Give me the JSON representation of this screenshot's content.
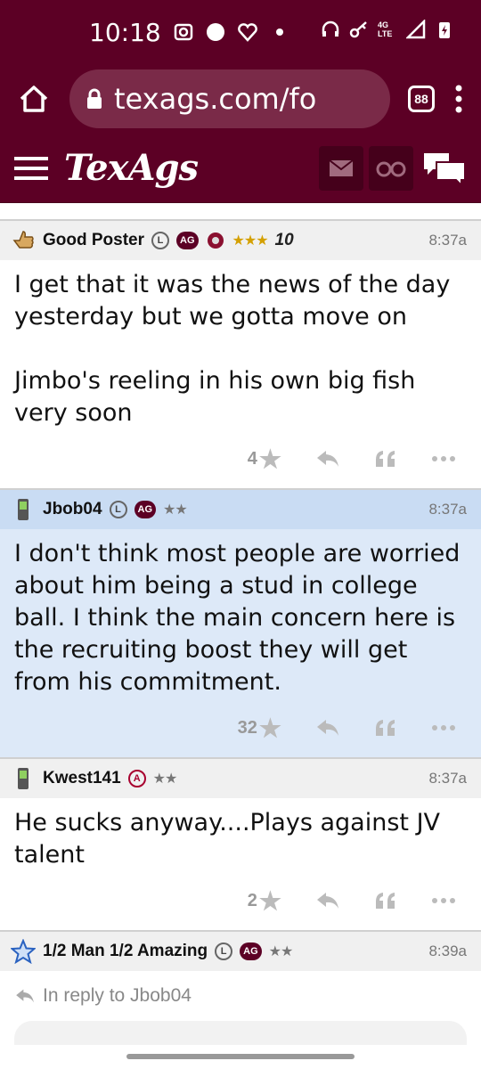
{
  "status": {
    "time": "10:18",
    "network": "4G LTE"
  },
  "browser": {
    "url": "texags.com/fo",
    "tab_count": "88"
  },
  "site": {
    "logo": "TexAgs"
  },
  "posts": [
    {
      "username": "Good Poster",
      "badges": [
        "L",
        "AG"
      ],
      "stars": "★★★",
      "ten": "10",
      "time": "8:37a",
      "body": "I get that it was the news of the day yesterday but we gotta move on\n\nJimbo's reeling in his own big fish very soon",
      "likes": "4",
      "highlighted": false
    },
    {
      "username": "Jbob04",
      "badges": [
        "L",
        "AG"
      ],
      "stars": "★★",
      "time": "8:37a",
      "body": "I don't think most people are worried about him being a stud in college ball. I think the main concern here is the recruiting boost they will get from his commitment.",
      "likes": "32",
      "highlighted": true
    },
    {
      "username": "Kwest141",
      "badges": [
        "A"
      ],
      "stars": "★★",
      "time": "8:37a",
      "body": "He sucks anyway....Plays against JV talent",
      "likes": "2",
      "highlighted": false
    },
    {
      "username": "1/2 Man 1/2 Amazing",
      "badges": [
        "L",
        "AG"
      ],
      "stars": "★★",
      "time": "8:39a",
      "reply_to": "In reply to Jbob04"
    }
  ],
  "colors": {
    "maroon": "#5c0025",
    "highlight": "#dde9f8"
  }
}
